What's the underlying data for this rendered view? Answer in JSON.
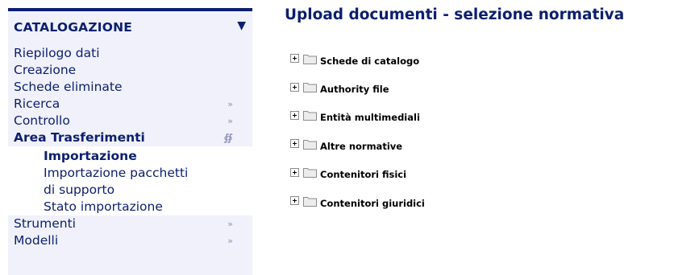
{
  "sidebar": {
    "header": "CATALOGAZIONE",
    "items": [
      {
        "label": "Riepilogo dati"
      },
      {
        "label": "Creazione"
      },
      {
        "label": "Schede eliminate"
      },
      {
        "label": "Ricerca"
      },
      {
        "label": "Controllo"
      },
      {
        "label": "Area Trasferimenti"
      },
      {
        "label": "Strumenti"
      },
      {
        "label": "Modelli"
      }
    ],
    "submenu": [
      {
        "label": "Importazione"
      },
      {
        "label_line1": "Importazione pacchetti",
        "label_line2": "di supporto"
      },
      {
        "label": "Stato importazione"
      }
    ]
  },
  "main": {
    "title": "Upload documenti - selezione normativa",
    "tree": [
      {
        "label": "Schede di catalogo"
      },
      {
        "label": "Authority file"
      },
      {
        "label": "Entità multimediali"
      },
      {
        "label": "Altre normative"
      },
      {
        "label": "Contenitori fisici"
      },
      {
        "label": "Contenitori giuridici"
      }
    ]
  },
  "icons": {
    "collapse": "triangle-down-icon",
    "submenu_arrow": "double-chevron-right-icon",
    "expanded_arrow": "double-chevron-down-icon",
    "tree_expand": "plus-box-icon",
    "tree_folder": "folder-icon"
  },
  "colors": {
    "brand": "#0c1f6e",
    "sidebar_bg": "#f0f1fb",
    "submenu_bg": "#ffffff",
    "chevron": "#8d92b8"
  }
}
